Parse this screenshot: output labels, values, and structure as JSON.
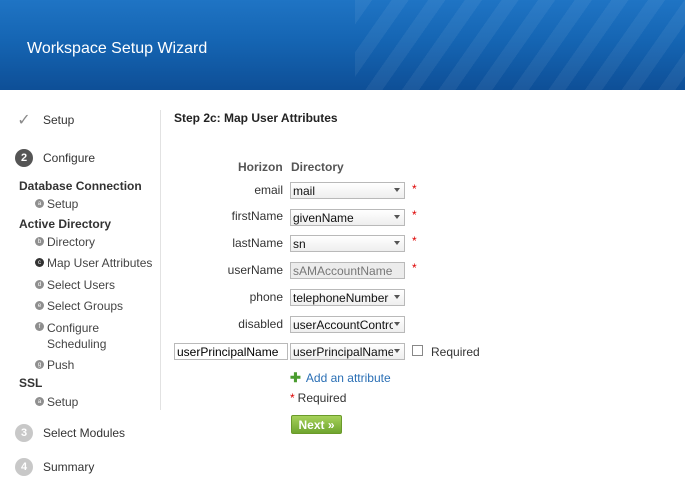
{
  "header": {
    "title": "Workspace Setup Wizard"
  },
  "sidebar": {
    "steps": [
      {
        "label": "Setup",
        "state": "done"
      },
      {
        "label": "Configure",
        "number": "2",
        "state": "current"
      },
      {
        "label": "Select Modules",
        "number": "3",
        "state": "pending"
      },
      {
        "label": "Summary",
        "number": "4",
        "state": "pending"
      }
    ],
    "groups": [
      {
        "label": "Database Connection"
      },
      {
        "label": "Active Directory"
      },
      {
        "label": "SSL"
      }
    ],
    "subitems": [
      {
        "bullet": "a",
        "label": "Setup"
      },
      {
        "bullet": "b",
        "label": "Directory"
      },
      {
        "bullet": "c",
        "label": "Map User Attributes"
      },
      {
        "bullet": "d",
        "label": "Select Users"
      },
      {
        "bullet": "e",
        "label": "Select Groups"
      },
      {
        "bullet": "f",
        "label": "Configure Scheduling"
      },
      {
        "bullet": "g",
        "label": "Push"
      },
      {
        "bullet": "a",
        "label": "Setup"
      }
    ]
  },
  "main": {
    "title": "Step 2c: Map User Attributes",
    "col_horizon": "Horizon",
    "col_directory": "Directory",
    "rows": [
      {
        "label": "email",
        "value": "mail",
        "required": "*"
      },
      {
        "label": "firstName",
        "value": "givenName",
        "required": "*"
      },
      {
        "label": "lastName",
        "value": "sn",
        "required": "*"
      },
      {
        "label": "userName",
        "value": "sAMAccountName",
        "required": "*"
      },
      {
        "label": "phone",
        "value": "telephoneNumber"
      },
      {
        "label": "disabled",
        "value": "userAccountControl"
      }
    ],
    "custom_row": {
      "attribute": "userPrincipalName",
      "value": "userPrincipalName",
      "checkbox_label": "Required"
    },
    "add_attribute": "Add an attribute",
    "required_note": "Required",
    "required_star": "*",
    "next_label": "Next »"
  },
  "colors": {
    "header": "#1565b3",
    "accent": "#2a6fb5",
    "required": "#dd0000",
    "next": "#7ab23a"
  }
}
